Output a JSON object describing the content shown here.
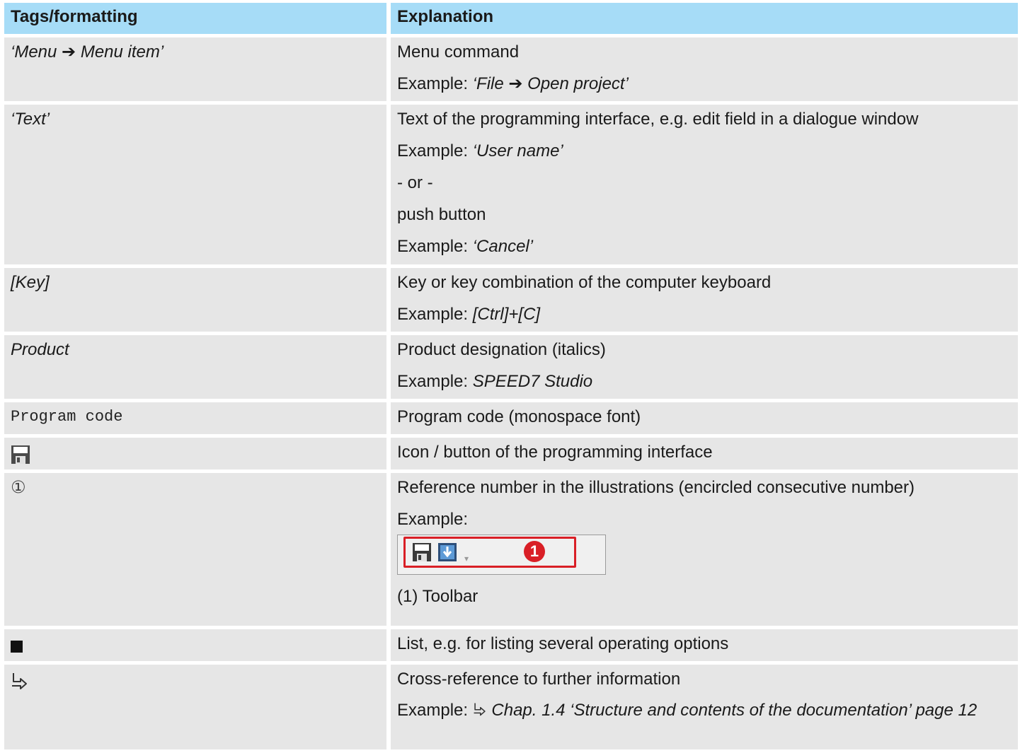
{
  "header": {
    "col1": "Tags/formatting",
    "col2": "Explanation"
  },
  "rows": {
    "menu": {
      "tag_a": "‘Menu ",
      "tag_arrow": "➔",
      "tag_b": " Menu item’",
      "desc": "Menu command",
      "ex_label": "Example: ",
      "ex_a": "‘File ",
      "ex_arrow": "➔",
      "ex_b": " Open project’"
    },
    "text": {
      "tag": "‘Text’",
      "desc": "Text of the programming interface, e.g. edit field in a dialogue window",
      "ex1_label": "Example: ",
      "ex1": "‘User name’",
      "or": "- or -",
      "push": "push button",
      "ex2_label": "Example: ",
      "ex2": "‘Cancel’"
    },
    "key": {
      "tag": "[Key]",
      "desc": "Key or key combination of the computer keyboard",
      "ex_label": "Example: ",
      "ex": "[Ctrl]+[C]"
    },
    "product": {
      "tag": "Product",
      "desc": "Product designation (italics)",
      "ex_label": "Example: ",
      "ex": "SPEED7 Studio"
    },
    "code": {
      "tag": "Program code",
      "desc": "Program code (monospace font)"
    },
    "icon": {
      "tag_icon": "floppy-disk-icon",
      "desc": "Icon / button of the programming interface"
    },
    "refnum": {
      "tag": "①",
      "desc": "Reference number in the illustrations (encircled consecutive number)",
      "ex_label": "Example:",
      "badge": "1",
      "caption": "(1) Toolbar"
    },
    "list": {
      "tag_icon": "black-square-bullet",
      "desc": "List, e.g. for listing several operating options"
    },
    "xref": {
      "tag_icon": "cross-reference-arrow-icon",
      "desc": "Cross-reference to further information",
      "ex_label": "Example: ",
      "ex": "Chap. 1.4 ‘Structure and contents of the documentation’ page 12"
    }
  },
  "colors": {
    "header_bg": "#a6dcf7",
    "cell_bg": "#e6e6e6",
    "badge_red": "#d91f26"
  }
}
